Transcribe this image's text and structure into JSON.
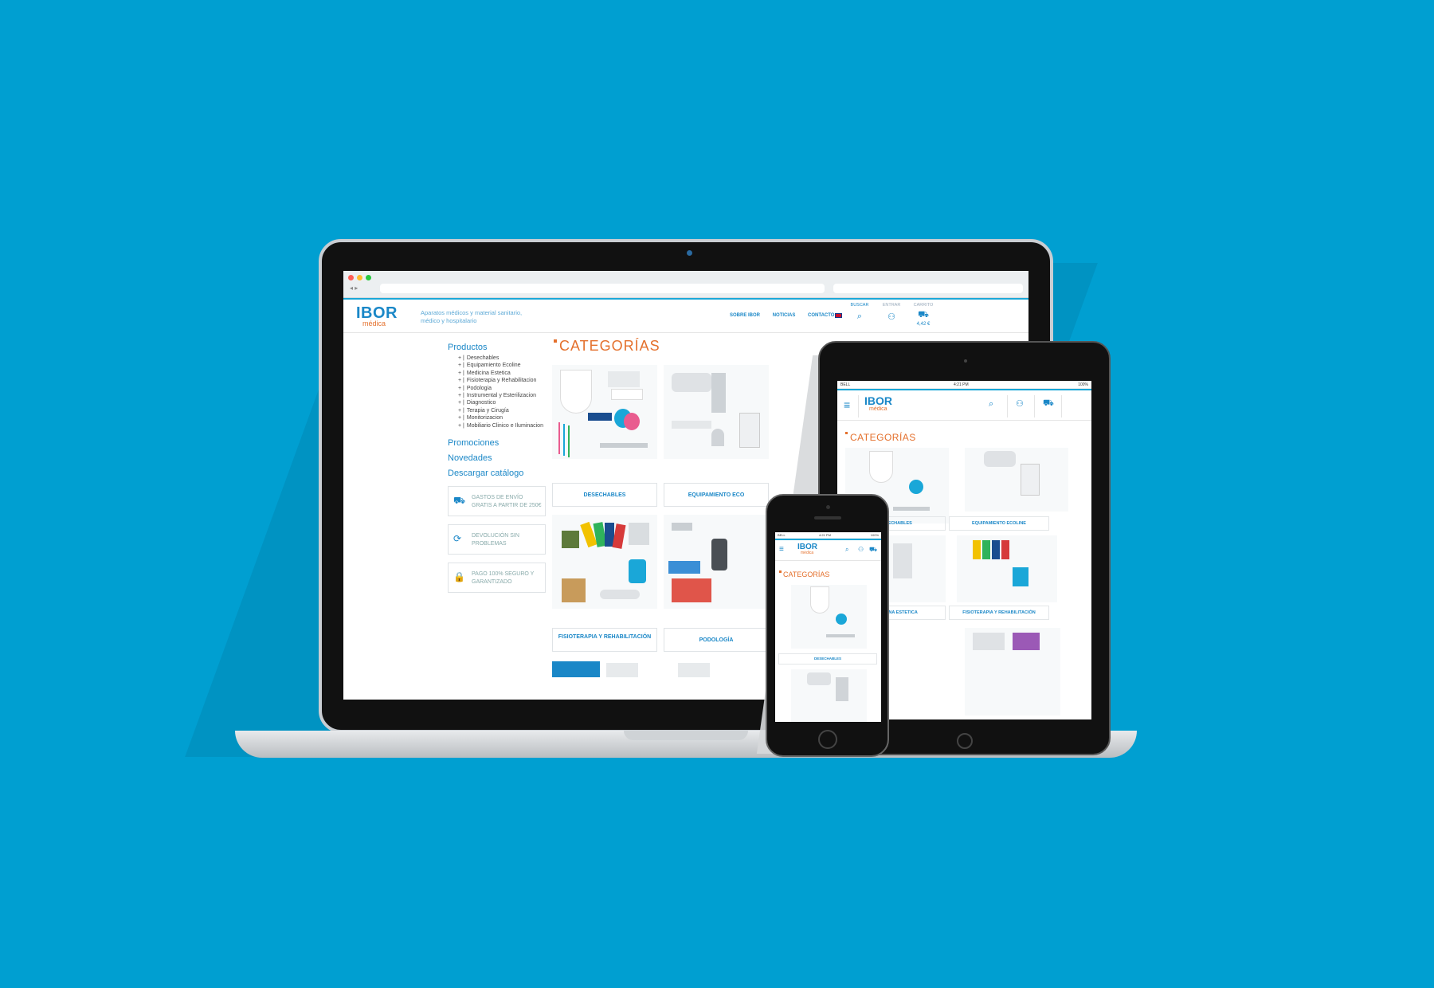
{
  "site": {
    "logo": "IBOR",
    "logo_sub": "médica",
    "tagline": "Aparatos médicos y material sanitario, médico y hospitalario",
    "nav": [
      "SOBRE IBOR",
      "NOTICIAS",
      "CONTACTO"
    ],
    "header_icons": [
      {
        "label": "BUSCAR",
        "icon": "search-icon"
      },
      {
        "label": "ENTRAR",
        "icon": "user-icon"
      },
      {
        "label": "CARRITO",
        "icon": "cart-icon"
      }
    ],
    "cart_total": "4,42 €",
    "accent_color": "#1a87c7",
    "highlight_color": "#e4702c",
    "background_color": "#009fd1"
  },
  "sidebar": {
    "title": "Productos",
    "items": [
      "Desechables",
      "Equipamiento Ecoline",
      "Medicina Estetica",
      "Fisioterapia y Rehabilitacion",
      "Podologia",
      "Instrumental y Esterilizacion",
      "Diagnostico",
      "Terapia y Cirugía",
      "Monitorizacion",
      "Mobiliario Clinico e Iluminacion"
    ],
    "links": [
      "Promociones",
      "Novedades",
      "Descargar catálogo"
    ],
    "features": [
      {
        "icon": "truck-icon",
        "text": "GASTOS DE ENVÍO GRATIS A PARTIR DE 250€"
      },
      {
        "icon": "refresh-icon",
        "text": "DEVOLUCIÓN SIN PROBLEMAS"
      },
      {
        "icon": "lock-icon",
        "text": "PAGO 100% SEGURO Y GARANTIZADO"
      }
    ]
  },
  "content": {
    "title": "CATEGORÍAS",
    "cards": [
      "DESECHABLES",
      "EQUIPAMIENTO ECO",
      "FISIOTERAPIA Y REHABILITACIÓN",
      "PODOLOGÍA"
    ]
  },
  "tablet": {
    "status_left": "BELL",
    "status_time": "4:21 PM",
    "status_right": "100%",
    "title": "CATEGORÍAS",
    "cards": [
      "DESECHABLES",
      "EQUIPAMIENTO ECOLINE",
      "MEDICINA ESTETICA",
      "FISIOTERAPIA Y REHABILITACIÓN"
    ]
  },
  "phone": {
    "status_left": "BELL",
    "status_time": "4:21 PM",
    "status_right": "100%",
    "title": "CATEGORÍAS",
    "cards": [
      "DESECHABLES"
    ]
  }
}
